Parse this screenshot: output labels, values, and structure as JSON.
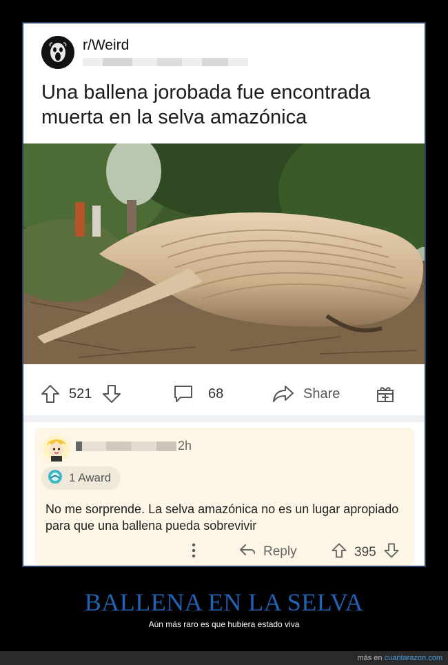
{
  "post": {
    "subreddit": "r/Weird",
    "title": "Una ballena jorobada fue encontrada muerta en la selva amazónica",
    "image_alt": "ballena jorobada en la selva",
    "upvotes": "521",
    "comments": "68",
    "share_label": "Share"
  },
  "comment": {
    "time": "2h",
    "award_label": "1 Award",
    "text": "No me sorprende. La selva amazónica no es un lugar apropiado para que una ballena pueda sobrevivir",
    "reply_label": "Reply",
    "score": "395"
  },
  "caption": {
    "title": "BALLENA EN LA SELVA",
    "subtitle": "Aún más raro es que hubiera estado viva"
  },
  "footer": {
    "prefix": "más en",
    "site": "cuantarazon.com"
  },
  "colors": {
    "caption_title": "#1f64b5",
    "frame_border": "#2c3e63",
    "comment_bg": "#fdf6e6"
  }
}
